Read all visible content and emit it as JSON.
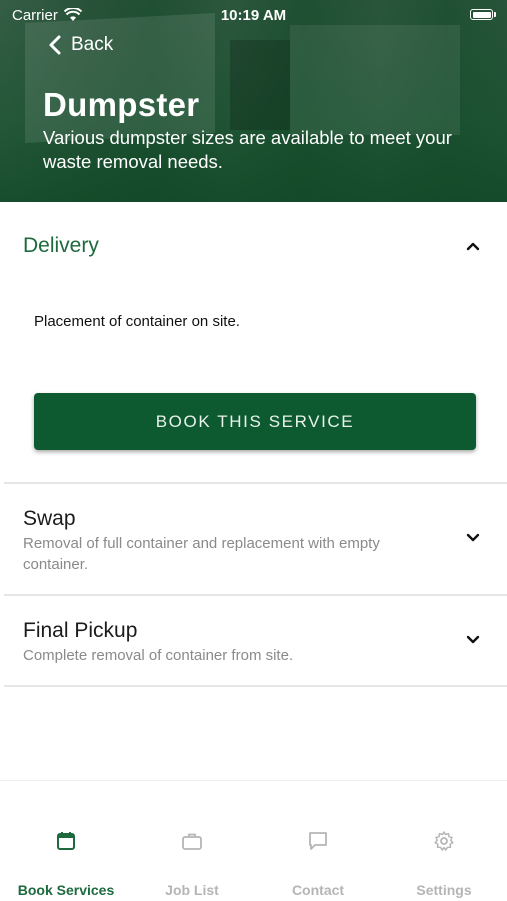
{
  "status_bar": {
    "carrier": "Carrier",
    "time": "10:19 AM"
  },
  "header": {
    "back_label": "Back",
    "title": "Dumpster",
    "subtitle": "Various dumpster sizes are available to meet your waste removal needs."
  },
  "services": {
    "delivery": {
      "title": "Delivery",
      "description": "Placement of container on site.",
      "button_label": "BOOK THIS SERVICE",
      "expanded": true
    },
    "swap": {
      "title": "Swap",
      "description": "Removal of full container and replacement with empty container.",
      "expanded": false
    },
    "final_pickup": {
      "title": "Final Pickup",
      "description": "Complete removal of container from site.",
      "expanded": false
    }
  },
  "tabbar": {
    "tabs": [
      {
        "label": "Book Services",
        "icon": "calendar-icon",
        "active": true
      },
      {
        "label": "Job List",
        "icon": "briefcase-icon",
        "active": false
      },
      {
        "label": "Contact",
        "icon": "chat-icon",
        "active": false
      },
      {
        "label": "Settings",
        "icon": "gear-icon",
        "active": false
      }
    ]
  },
  "colors": {
    "brand_green": "#0e5a30",
    "accent_green": "#1e6a3e",
    "inactive": "#b5b5b5"
  }
}
